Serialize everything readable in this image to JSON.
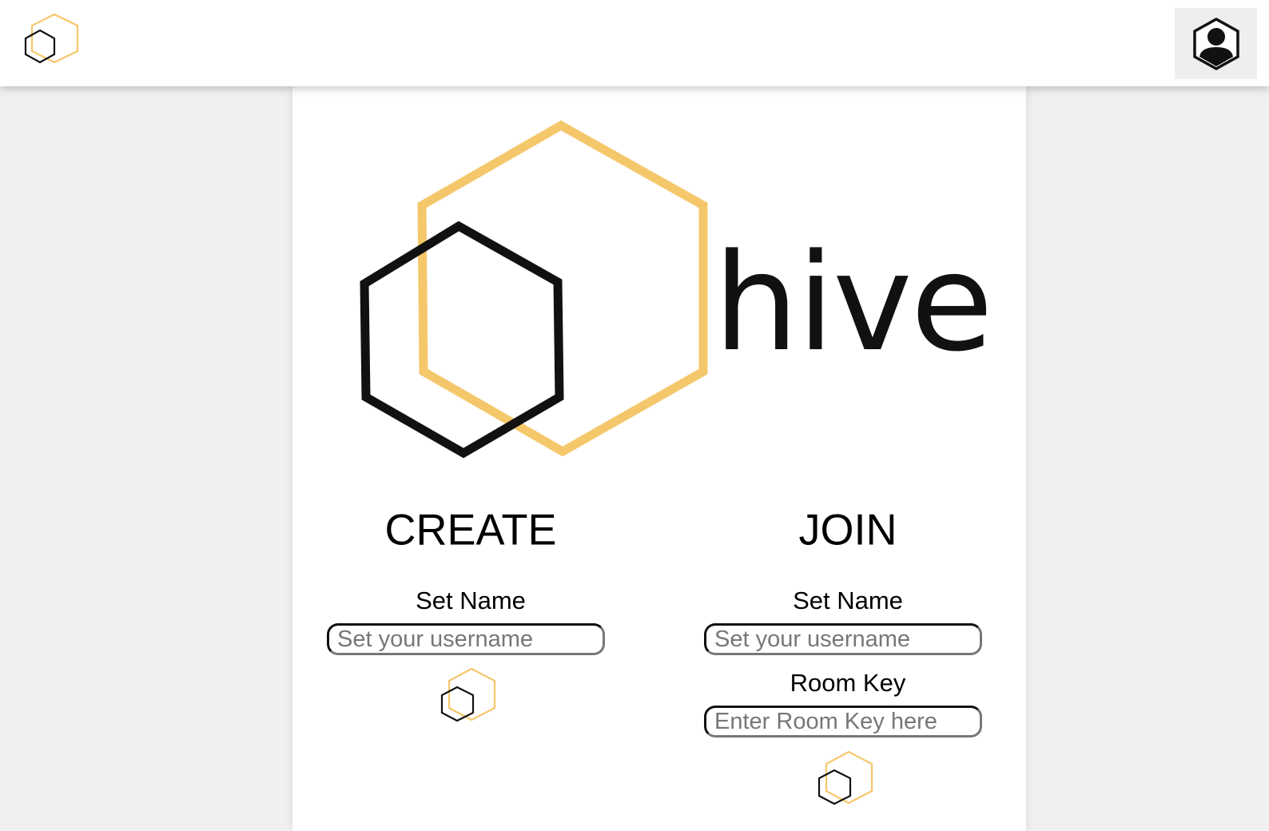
{
  "header": {
    "logo_icon": "hive-hexagon-logo-icon",
    "profile_icon": "user-hexagon-icon"
  },
  "hero": {
    "logo_text": "hive",
    "colors": {
      "honey": "#f5c76b",
      "black": "#111111"
    }
  },
  "create": {
    "title": "CREATE",
    "name_label": "Set Name",
    "name_placeholder": "Set your username",
    "submit_icon": "hive-hexagon-logo-icon"
  },
  "join": {
    "title": "JOIN",
    "name_label": "Set Name",
    "name_placeholder": "Set your username",
    "room_key_label": "Room Key",
    "room_key_placeholder": "Enter Room Key here",
    "submit_icon": "hive-hexagon-logo-icon"
  }
}
